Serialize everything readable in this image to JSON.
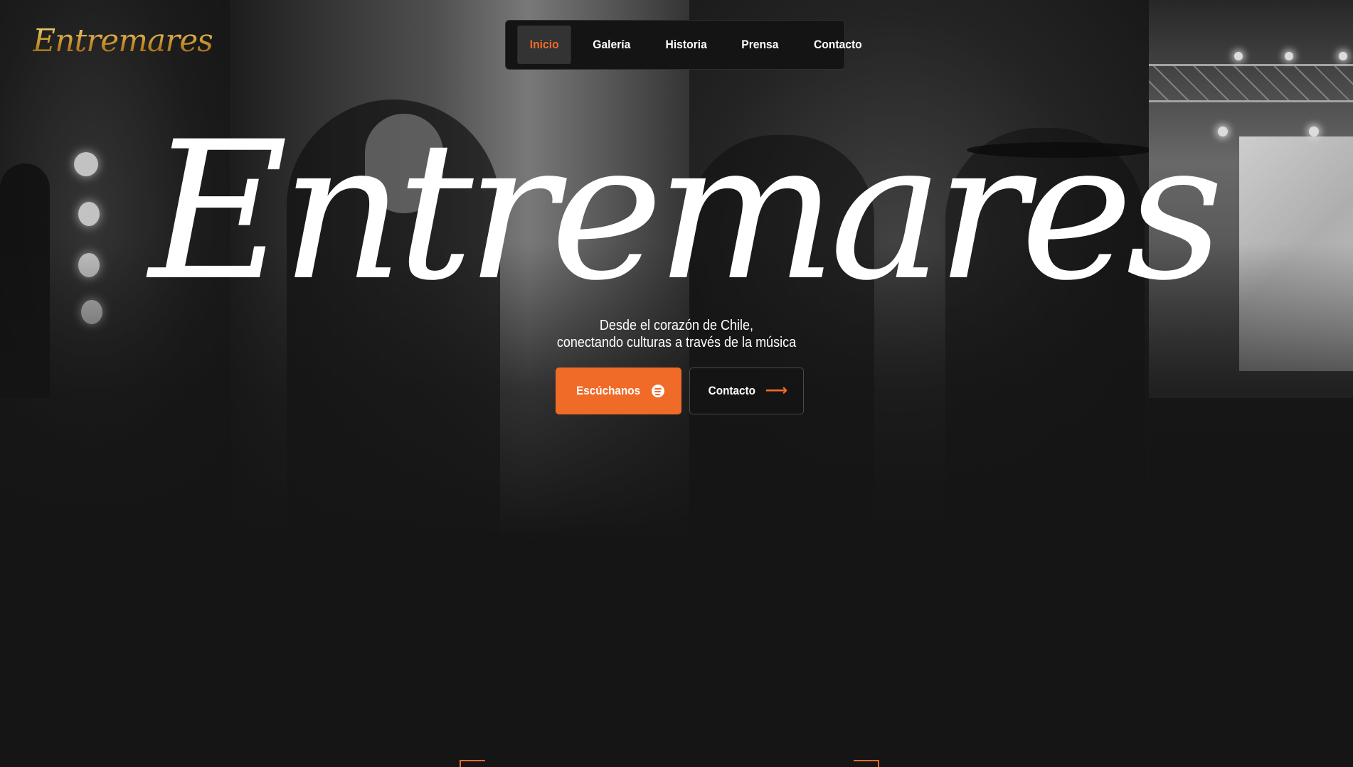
{
  "brand": {
    "logo_text": "Entremares"
  },
  "nav": {
    "items": [
      {
        "label": "Inicio",
        "active": true
      },
      {
        "label": "Galería",
        "active": false
      },
      {
        "label": "Historia",
        "active": false
      },
      {
        "label": "Prensa",
        "active": false
      },
      {
        "label": "Contacto",
        "active": false
      }
    ]
  },
  "hero": {
    "title": "Entremares",
    "tagline_line1": "Desde el corazón de Chile,",
    "tagline_line2": "conectando culturas a través de la música",
    "listen_button_label": "Escúchanos",
    "listen_button_icon": "spotify-icon",
    "contact_button_label": "Contacto",
    "contact_button_icon": "arrow-right-icon"
  },
  "colors": {
    "accent": "#f06a28",
    "background": "#151515",
    "nav_active_bg": "#333333",
    "logo_gold": "#d9a73d"
  }
}
